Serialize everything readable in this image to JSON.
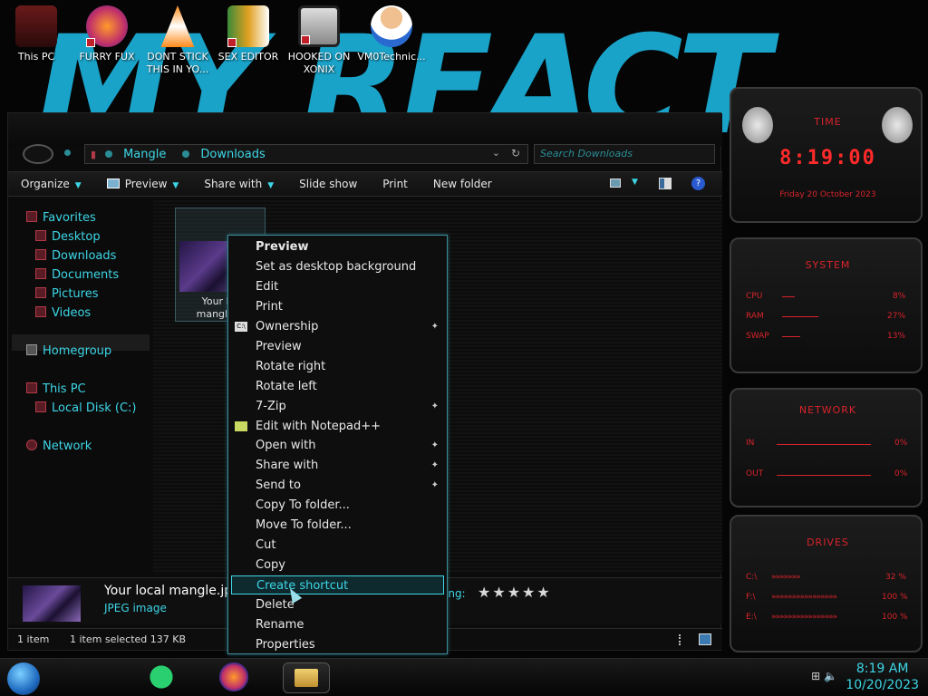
{
  "desktop": {
    "wallpaper_text": "MY REACT",
    "icons": [
      {
        "label": "This PC"
      },
      {
        "label": "FURRY FUX"
      },
      {
        "label": "DONT STICK THIS IN YO..."
      },
      {
        "label": "SEX EDITOR"
      },
      {
        "label": "HOOKED ON XONIX"
      },
      {
        "label": "VM0Technic..."
      }
    ]
  },
  "explorer": {
    "address": {
      "crumb1": "Mangle",
      "crumb2": "Downloads"
    },
    "search_placeholder": "Search Downloads",
    "toolbar": {
      "organize": "Organize",
      "preview": "Preview",
      "share_with": "Share with",
      "slide_show": "Slide show",
      "print": "Print",
      "new_folder": "New folder"
    },
    "nav": {
      "favorites": "Favorites",
      "desktop": "Desktop",
      "downloads": "Downloads",
      "documents": "Documents",
      "pictures": "Pictures",
      "videos": "Videos",
      "homegroup": "Homegroup",
      "this_pc": "This PC",
      "local_disk": "Local Disk (C:)",
      "network": "Network"
    },
    "file": {
      "label_line1": "Your loc",
      "label_line2": "mangle.jp"
    },
    "details": {
      "name": "Your local mangle.jpg",
      "type": "JPEG image",
      "rating_label": "ing:",
      "rating_stars": "★★★★★"
    },
    "status": {
      "count": "1 item",
      "selected": "1 item selected  137 KB"
    }
  },
  "context_menu": {
    "items": [
      {
        "label": "Preview",
        "bold": true
      },
      {
        "label": "Set as desktop background"
      },
      {
        "label": "Edit"
      },
      {
        "label": "Print"
      },
      {
        "label": "Ownership",
        "submenu": true
      },
      {
        "label": "Preview"
      },
      {
        "label": "Rotate right"
      },
      {
        "label": "Rotate left"
      },
      {
        "label": "7-Zip",
        "submenu": true
      },
      {
        "label": "Edit with Notepad++"
      },
      {
        "label": "Open with",
        "submenu": true
      },
      {
        "label": "Share with",
        "submenu": true
      },
      {
        "label": "Send to",
        "submenu": true
      },
      {
        "label": "Copy To folder..."
      },
      {
        "label": "Move To folder..."
      },
      {
        "label": "Cut"
      },
      {
        "label": "Copy"
      },
      {
        "label": "Create shortcut",
        "highlighted": true
      },
      {
        "label": "Delete"
      },
      {
        "label": "Rename"
      },
      {
        "label": "Properties"
      }
    ],
    "submenu_glyph": "✦"
  },
  "gadgets": {
    "time": {
      "title": "TIME",
      "clock": "8:19:00",
      "date": "Friday 20 October 2023"
    },
    "system": {
      "title": "SYSTEM",
      "cpu_label": "CPU",
      "cpu_value": "8%",
      "ram_label": "RAM",
      "ram_value": "27%",
      "swap_label": "SWAP",
      "swap_value": "13%"
    },
    "network": {
      "title": "NETWORK",
      "in_label": "IN",
      "in_value": "0%",
      "out_label": "OUT",
      "out_value": "0%"
    },
    "drives": {
      "title": "DRIVES",
      "c_label": "C:\\",
      "c_value": "32 %",
      "f_label": "F:\\",
      "f_value": "100 %",
      "e_label": "E:\\",
      "e_value": "100 %"
    }
  },
  "taskbar": {
    "time": "8:19 AM",
    "date": "10/20/2023"
  },
  "colors": {
    "accent": "#3dd6e6",
    "gadget_red": "#d9232b",
    "wallpaper_blue": "#1aa3c9"
  }
}
